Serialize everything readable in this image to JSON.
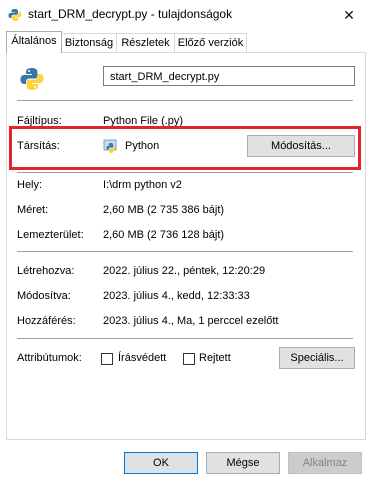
{
  "window": {
    "title": "start_DRM_decrypt.py - tulajdonságok",
    "close_glyph": "✕"
  },
  "tabs": [
    {
      "label": "Általános",
      "active": true
    },
    {
      "label": "Biztonság",
      "active": false
    },
    {
      "label": "Részletek",
      "active": false
    },
    {
      "label": "Előző verziók",
      "active": false
    }
  ],
  "general": {
    "file_name": "start_DRM_decrypt.py",
    "file_type_label": "Fájltípus:",
    "file_type_value": "Python File (.py)",
    "opens_with_label": "Társítás:",
    "opens_with_value": "Python",
    "change_button": "Módosítás...",
    "location_label": "Hely:",
    "location_value": "I:\\drm python v2",
    "size_label": "Méret:",
    "size_value": "2,60 MB (2 735 386 bájt)",
    "size_on_disk_label": "Lemezterület:",
    "size_on_disk_value": "2,60 MB (2 736 128 bájt)",
    "created_label": "Létrehozva:",
    "created_value": "2022. július 22., péntek, 12:20:29",
    "modified_label": "Módosítva:",
    "modified_value": "2023. július 4., kedd, 12:33:33",
    "accessed_label": "Hozzáférés:",
    "accessed_value": "2023. július 4., Ma, 1 perccel ezelőtt",
    "attributes_label": "Attribútumok:",
    "readonly_label": "Írásvédett",
    "readonly_checked": false,
    "hidden_label": "Rejtett",
    "hidden_checked": false,
    "advanced_button": "Speciális..."
  },
  "footer": {
    "ok_label": "OK",
    "cancel_label": "Mégse",
    "apply_label": "Alkalmaz"
  },
  "colors": {
    "highlight": "#e3242b",
    "accent": "#0078d7",
    "python_blue": "#3776ab",
    "python_yellow": "#ffd43b"
  }
}
